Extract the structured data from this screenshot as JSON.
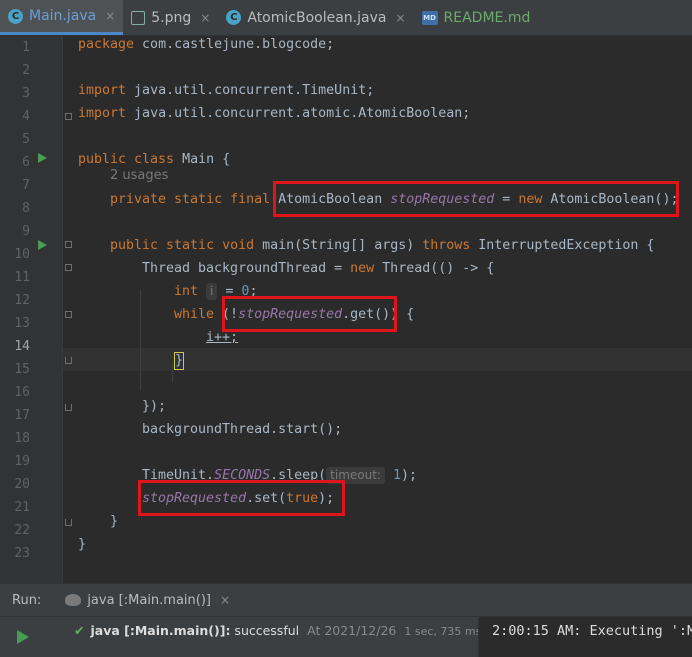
{
  "tabs": [
    {
      "label": "Main.java",
      "icon": "c",
      "active": true
    },
    {
      "label": "5.png",
      "icon": "image-icon"
    },
    {
      "label": "AtomicBoolean.java",
      "icon": "c"
    },
    {
      "label": "README.md",
      "icon": "md"
    }
  ],
  "close_glyph": "×",
  "line_numbers": [
    "1",
    "2",
    "3",
    "4",
    "5",
    "6",
    "7",
    "8",
    "9",
    "10",
    "11",
    "12",
    "13",
    "14",
    "15",
    "16",
    "17",
    "18",
    "19",
    "20",
    "21",
    "22",
    "23"
  ],
  "current_line": "14",
  "code": {
    "l1": {
      "kw": "package",
      "rest": " com.castlejune.blogcode;"
    },
    "l3": {
      "kw": "import",
      "rest": " java.util.concurrent.TimeUnit;"
    },
    "l4": {
      "kw": "import",
      "rest": " java.util.concurrent.atomic.AtomicBoolean;"
    },
    "l6": {
      "kw": "public class",
      "rest": " Main {"
    },
    "usages_hint": "2 usages",
    "l7": {
      "kw": "private static final",
      "type": "AtomicBoolean",
      "field": "stopRequested",
      "eq": " = ",
      "kw2": "new",
      "rest": " AtomicBoolean();"
    },
    "l9": {
      "kw": "public static void",
      "rest": " main(String[] args) ",
      "kw2": "throws",
      "rest2": " InterruptedException {"
    },
    "l10": {
      "pre": "Thread backgroundThread = ",
      "kw": "new",
      "rest": " Thread(() -> {"
    },
    "l11": {
      "kw": "int",
      "var": "i",
      "eq": " = ",
      "num": "0",
      "end": ";"
    },
    "l12": {
      "kw": "while",
      "pre": " (!",
      "field": "stopRequested",
      "rest": ".get()) {"
    },
    "l13": {
      "text": "i++;"
    },
    "l14": {
      "text": "}"
    },
    "l16": {
      "text": "});"
    },
    "l17": {
      "text": "backgroundThread.start();"
    },
    "l19": {
      "pre": "TimeUnit.",
      "field": "SECONDS",
      "rest": ".sleep(",
      "hint": "timeout:",
      "num": "1",
      "end": ");"
    },
    "l20": {
      "field": "stopRequested",
      "rest": ".set(",
      "kw": "true",
      "end": ");"
    },
    "l21": {
      "text": "}"
    },
    "l22": {
      "text": "}"
    }
  },
  "run_panel": {
    "label": "Run:",
    "tab_label": "java [:Main.main()]",
    "tree_name": "java [:Main.main()]:",
    "tree_status": " successful",
    "tree_time": "At 2021/12/26",
    "tree_duration": "1 sec, 735 ms",
    "console_text": "2:00:15 AM: Executing ':M"
  },
  "colors": {
    "accent": "#4a88c7",
    "highlight_box": "#e0151b",
    "run_green": "#499c54"
  }
}
